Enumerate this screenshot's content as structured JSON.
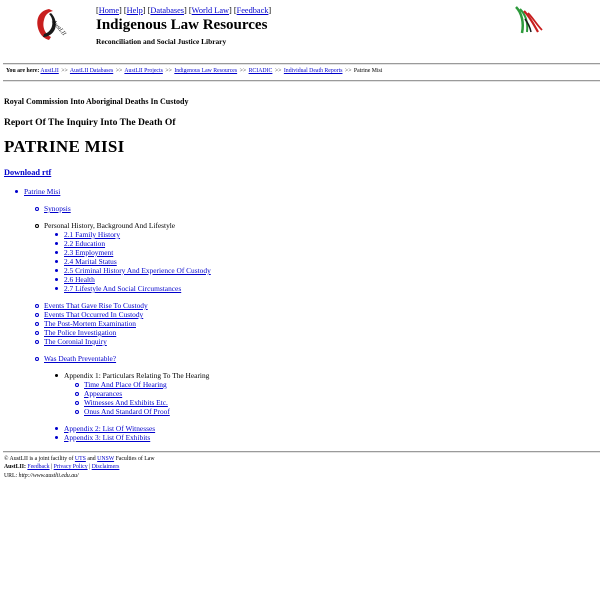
{
  "header": {
    "nav_items": [
      "Home",
      "Help",
      "Databases",
      "World Law",
      "Feedback"
    ],
    "title": "Indigenous Law Resources",
    "subtitle": "Reconciliation and Social Justice Library",
    "logo_left_text": "AustLII",
    "logo_left_icon": "austlii-logo-icon",
    "logo_right_icon": "reconciliation-logo-icon"
  },
  "breadcrumb": {
    "label": "You are here:",
    "items": [
      "AustLII",
      "AustLII Databases",
      "AustLII Projects",
      "Indigenous Law Resources",
      "RCIADIC",
      "Individual Death Reports"
    ],
    "separator": ">>",
    "current": "Patrine Misi"
  },
  "document": {
    "commission": "Royal Commission Into Aboriginal Deaths In Custody",
    "report_title": "Report Of The Inquiry Into The Death Of",
    "person_name": "PATRINE MISI",
    "download_label": "Download rtf"
  },
  "toc": {
    "root": "Patrine Misi",
    "synopsis": "Synopsis",
    "personal_history": "Personal History, Background And Lifestyle",
    "personal_history_items": [
      "2.1 Family History",
      "2.2 Education",
      "2.3 Employment",
      "2.4 Marital Status",
      "2.5 Criminal History And Experience Of Custody",
      "2.6 Health",
      "2.7 Lifestyle And Social Circumstances"
    ],
    "events_items": [
      "Events That Gave Rise To Custody",
      "Events That Occurred In Custody",
      "The Post-Mortem Examination",
      "The Police Investigation",
      "The Coronial Inquiry"
    ],
    "preventable": "Was Death Preventable?",
    "appendix1": "Appendix 1: Particulars Relating To The Hearing",
    "appendix1_items": [
      "Time And Place Of Hearing",
      "Appearances",
      "Witnesses And Exhibits Etc.",
      "Onus And Standard Of Proof"
    ],
    "appendix_items": [
      "Appendix 2: List Of Witnesses",
      "Appendix 3: List Of Exhibits"
    ]
  },
  "footer": {
    "copyright_prefix": "© AustLII is a joint facility of",
    "uts": "UTS",
    "and": "and",
    "unsw": "UNSW",
    "faculties": "Faculties of Law",
    "austlii_label": "AustLII:",
    "links": [
      "Feedback",
      "Privacy Policy",
      "Disclaimers"
    ],
    "url_label": "URL:",
    "url": "http://www.austlii.edu.au/"
  },
  "colors": {
    "link": "#0000cc",
    "logo_red": "#c81e1e",
    "logo_green": "#2e9a3c",
    "rule": "#9a9a9a"
  }
}
